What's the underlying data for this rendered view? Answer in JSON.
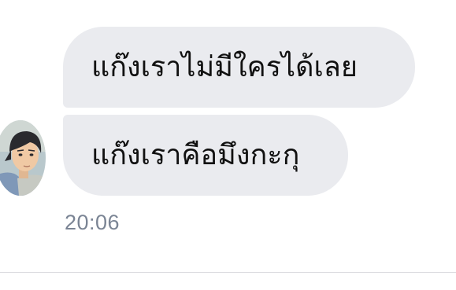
{
  "messages": [
    {
      "text": "แก๊งเราไม่มีใครได้เลย"
    },
    {
      "text": "แก๊งเราคือมึงกะกุ"
    }
  ],
  "timestamp": "20:06",
  "sender": {
    "avatar_icon": "illustrated-person-avatar"
  },
  "colors": {
    "bubble": "#eaebef",
    "timestamp": "#7a8494",
    "divider": "#d8d9dd"
  }
}
